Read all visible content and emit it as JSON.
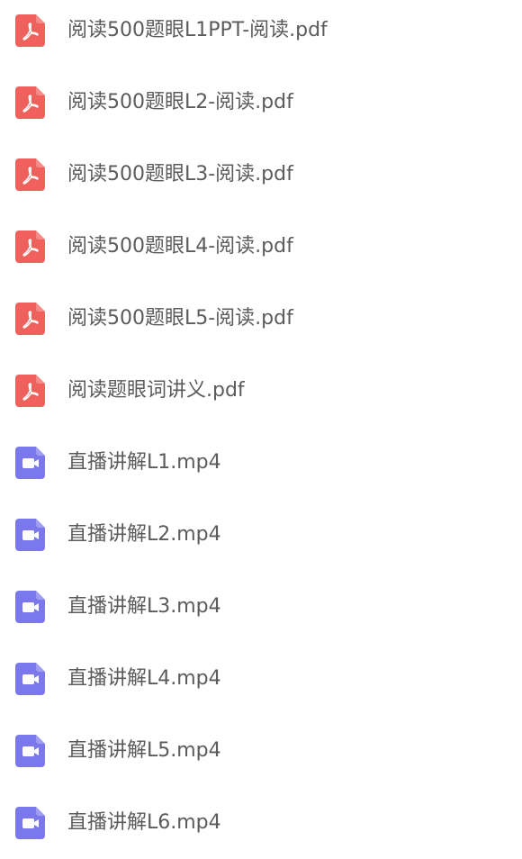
{
  "files": [
    {
      "name": "阅读500题眼L1PPT-阅读.pdf",
      "icon": "pdf-file-icon",
      "color": "#f0615d"
    },
    {
      "name": "阅读500题眼L2-阅读.pdf",
      "icon": "pdf-file-icon",
      "color": "#f0615d"
    },
    {
      "name": "阅读500题眼L3-阅读.pdf",
      "icon": "pdf-file-icon",
      "color": "#f0615d"
    },
    {
      "name": "阅读500题眼L4-阅读.pdf",
      "icon": "pdf-file-icon",
      "color": "#f0615d"
    },
    {
      "name": "阅读500题眼L5-阅读.pdf",
      "icon": "pdf-file-icon",
      "color": "#f0615d"
    },
    {
      "name": "阅读题眼词讲义.pdf",
      "icon": "pdf-file-icon",
      "color": "#f0615d"
    },
    {
      "name": "直播讲解L1.mp4",
      "icon": "video-file-icon",
      "color": "#7a78ec"
    },
    {
      "name": "直播讲解L2.mp4",
      "icon": "video-file-icon",
      "color": "#7a78ec"
    },
    {
      "name": "直播讲解L3.mp4",
      "icon": "video-file-icon",
      "color": "#7a78ec"
    },
    {
      "name": "直播讲解L4.mp4",
      "icon": "video-file-icon",
      "color": "#7a78ec"
    },
    {
      "name": "直播讲解L5.mp4",
      "icon": "video-file-icon",
      "color": "#7a78ec"
    },
    {
      "name": "直播讲解L6.mp4",
      "icon": "video-file-icon",
      "color": "#7a78ec"
    }
  ]
}
